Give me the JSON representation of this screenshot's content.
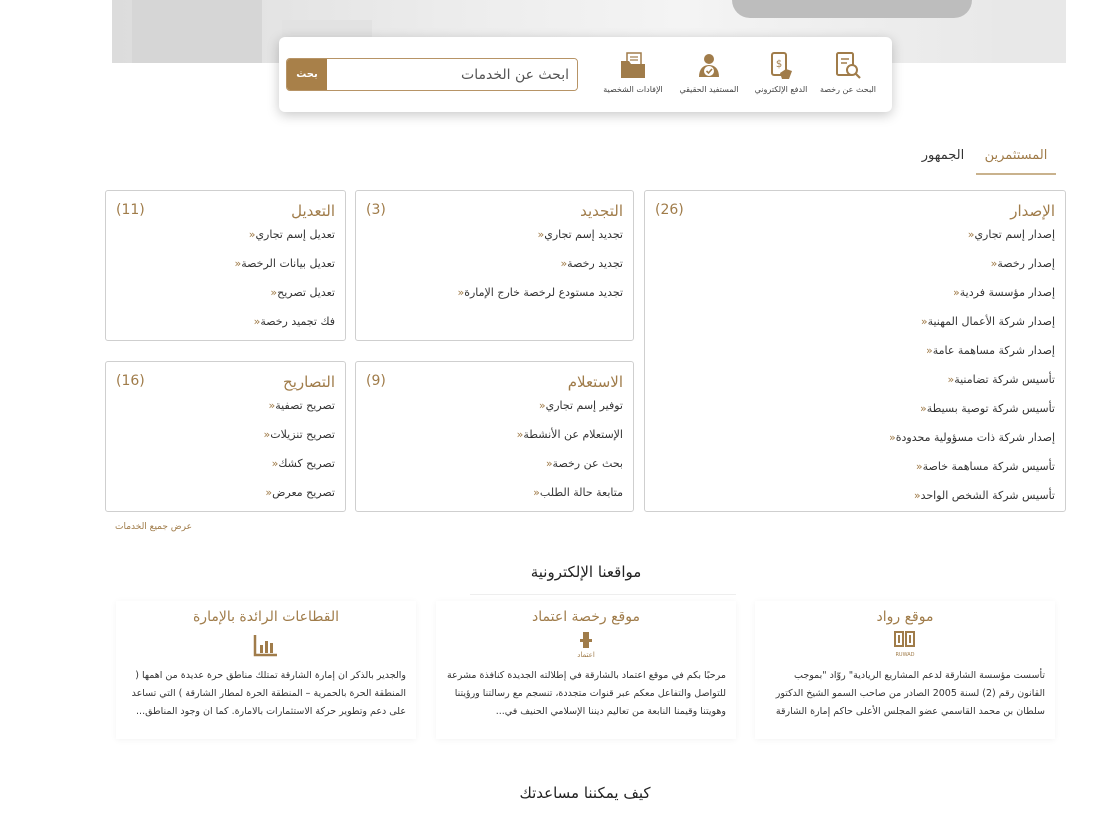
{
  "search": {
    "placeholder": "ابحث عن الخدمات",
    "button": "بحث"
  },
  "quick_links": [
    {
      "label": "البحث عن رخصة",
      "icon": "license-search-icon"
    },
    {
      "label": "الدفع الإلكتروني",
      "icon": "mobile-payment-icon"
    },
    {
      "label": "المستفيد الحقيقي",
      "icon": "beneficiary-icon"
    },
    {
      "label": "الإفادات الشخصية",
      "icon": "folder-icon"
    }
  ],
  "tabs": {
    "investors": "المستثمرين",
    "public": "الجمهور"
  },
  "boxes": {
    "issuance": {
      "title": "الإصدار",
      "count": "(26)",
      "items": [
        "إصدار إسم تجاري",
        "إصدار رخصة",
        "إصدار مؤسسة فردية",
        "إصدار شركة الأعمال المهنية",
        "إصدار شركة مساهمة عامة",
        "تأسيس شركة تضامنية",
        "تأسيس شركة توصية بسيطة",
        "إصدار شركة ذات مسؤولية محدودة",
        "تأسيس شركة مساهمة خاصة",
        "تأسيس شركة الشخص الواحد"
      ]
    },
    "renewal": {
      "title": "التجديد",
      "count": "(3)",
      "items": [
        "تجديد إسم تجاري",
        "تجديد رخصة",
        "تجديد مستودع لرخصة خارج الإمارة"
      ]
    },
    "modification": {
      "title": "التعديل",
      "count": "(11)",
      "items": [
        "تعديل إسم تجاري",
        "تعديل بيانات الرخصة",
        "تعديل تصريح",
        "فك تجميد رخصة"
      ]
    },
    "inquiry": {
      "title": "الاستعلام",
      "count": "(9)",
      "items": [
        "توفير إسم تجاري",
        "الإستعلام عن الأنشطة",
        "بحث عن رخصة",
        "متابعة حالة الطلب"
      ]
    },
    "permits": {
      "title": "التصاريح",
      "count": "(16)",
      "items": [
        "تصريح تصفية",
        "تصريح تنزيلات",
        "تصريح كشك",
        "تصريح معرض"
      ]
    }
  },
  "view_all": "عرض جميع الخدمات",
  "websites": {
    "heading": "مواقعنا الإلكترونية",
    "items": [
      {
        "title": "موقع رواد",
        "logo_text": "RUWAD",
        "text": "تأسست مؤسسة الشارقة لدعم المشاريع الريادية\" روّاد \"بموجب القانون رقم (2) لسنة 2005 الصادر من صاحب السمو الشيخ الدكتور سلطان بن محمد القاسمي عضو المجلس الأعلى حاكم إمارة الشارقة"
      },
      {
        "title": "موقع رخصة اعتماد",
        "logo_text": "اعتماد",
        "text": "مرحبًا بكم في موقع اعتماد بالشارقة في إطلالته الجديدة كنافذة مشرعة للتواصل والتفاعل معكم عبر قنوات متجددة، تنسجم مع رسالتنا ورؤيتنا وهويتنا وقيمنا النابعة من تعاليم ديننا الإسلامي الحنيف في..."
      },
      {
        "title": "القطاعات الرائدة بالإمارة",
        "logo_text": "",
        "text": "والجدير بالذكر ان إمارة الشارقة تمتلك مناطق حرة عديدة من اهمها ( المنطقة الحرة بالحمرية – المنطقة الحرة لمطار الشارقة ) التي تساعد على دعم وتطوير حركة الاستثمارات بالامارة. كما ان وجود المناطق..."
      }
    ]
  },
  "help_heading": "كيف يمكننا مساعدتك",
  "colors": {
    "accent": "#a07c4a",
    "button": "#a88049",
    "border": "#cfcfcf"
  }
}
